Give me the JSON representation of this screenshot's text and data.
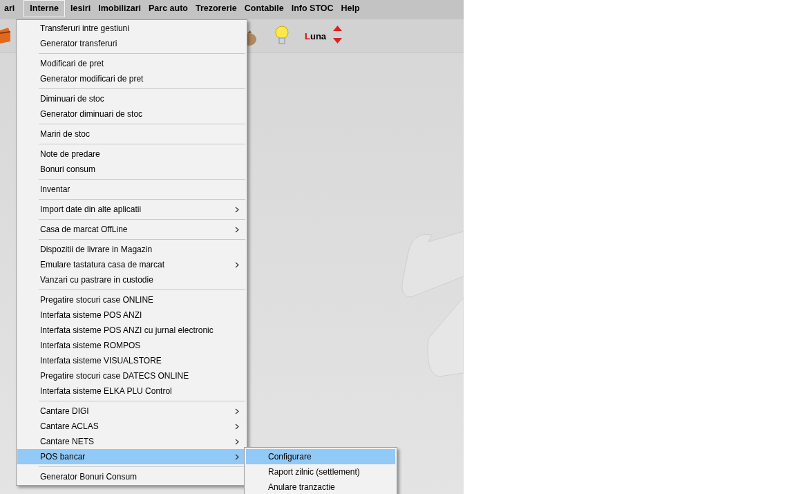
{
  "menubar": [
    {
      "label": "ari",
      "selected": false
    },
    {
      "label": "Interne",
      "selected": true
    },
    {
      "label": "Iesiri",
      "selected": false
    },
    {
      "label": "Imobilizari",
      "selected": false
    },
    {
      "label": "Parc auto",
      "selected": false
    },
    {
      "label": "Trezorerie",
      "selected": false
    },
    {
      "label": "Contabile",
      "selected": false
    },
    {
      "label": "Info STOC",
      "selected": false
    },
    {
      "label": "Help",
      "selected": false
    }
  ],
  "toolbar": {
    "period_label": "Luna"
  },
  "menu": {
    "groups": [
      {
        "items": [
          {
            "label": "Transferuri intre gestiuni",
            "has_submenu": false,
            "selected": false
          },
          {
            "label": "Generator transferuri",
            "has_submenu": false,
            "selected": false
          }
        ]
      },
      {
        "items": [
          {
            "label": "Modificari de pret",
            "has_submenu": false,
            "selected": false
          },
          {
            "label": "Generator modificari de pret",
            "has_submenu": false,
            "selected": false
          }
        ]
      },
      {
        "items": [
          {
            "label": "Diminuari de stoc",
            "has_submenu": false,
            "selected": false
          },
          {
            "label": "Generator diminuari de stoc",
            "has_submenu": false,
            "selected": false
          }
        ]
      },
      {
        "items": [
          {
            "label": "Mariri de stoc",
            "has_submenu": false,
            "selected": false
          }
        ]
      },
      {
        "items": [
          {
            "label": "Note de predare",
            "has_submenu": false,
            "selected": false
          },
          {
            "label": "Bonuri consum",
            "has_submenu": false,
            "selected": false
          }
        ]
      },
      {
        "items": [
          {
            "label": "Inventar",
            "has_submenu": false,
            "selected": false
          }
        ]
      },
      {
        "items": [
          {
            "label": "Import date din alte aplicatii",
            "has_submenu": true,
            "selected": false
          }
        ]
      },
      {
        "items": [
          {
            "label": "Casa de marcat OffLine",
            "has_submenu": true,
            "selected": false
          }
        ]
      },
      {
        "items": [
          {
            "label": "Dispozitii de livrare in Magazin",
            "has_submenu": false,
            "selected": false
          },
          {
            "label": "Emulare tastatura casa de marcat",
            "has_submenu": true,
            "selected": false
          },
          {
            "label": "Vanzari cu pastrare in custodie",
            "has_submenu": false,
            "selected": false
          }
        ]
      },
      {
        "items": [
          {
            "label": "Pregatire stocuri case ONLINE",
            "has_submenu": false,
            "selected": false
          },
          {
            "label": "Interfata sisteme POS ANZI",
            "has_submenu": false,
            "selected": false
          },
          {
            "label": "Interfata sisteme POS ANZI cu jurnal electronic",
            "has_submenu": false,
            "selected": false
          },
          {
            "label": "Interfata sisteme ROMPOS",
            "has_submenu": false,
            "selected": false
          },
          {
            "label": "Interfata sisteme VISUALSTORE",
            "has_submenu": false,
            "selected": false
          },
          {
            "label": "Pregatire stocuri case DATECS ONLINE",
            "has_submenu": false,
            "selected": false
          },
          {
            "label": "Interfata sisteme ELKA PLU Control",
            "has_submenu": false,
            "selected": false
          }
        ]
      },
      {
        "items": [
          {
            "label": "Cantare DIGI",
            "has_submenu": true,
            "selected": false
          },
          {
            "label": "Cantare ACLAS",
            "has_submenu": true,
            "selected": false
          },
          {
            "label": "Cantare NETS",
            "has_submenu": true,
            "selected": false
          },
          {
            "label": "POS bancar",
            "has_submenu": true,
            "selected": true
          }
        ]
      },
      {
        "items": [
          {
            "label": "Generator Bonuri Consum",
            "has_submenu": false,
            "selected": false
          }
        ]
      }
    ]
  },
  "submenu": {
    "items": [
      {
        "label": "Configurare",
        "selected": true
      },
      {
        "label": "Raport zilnic (settlement)",
        "selected": false
      },
      {
        "label": "Anulare tranzactie",
        "selected": false
      }
    ]
  }
}
